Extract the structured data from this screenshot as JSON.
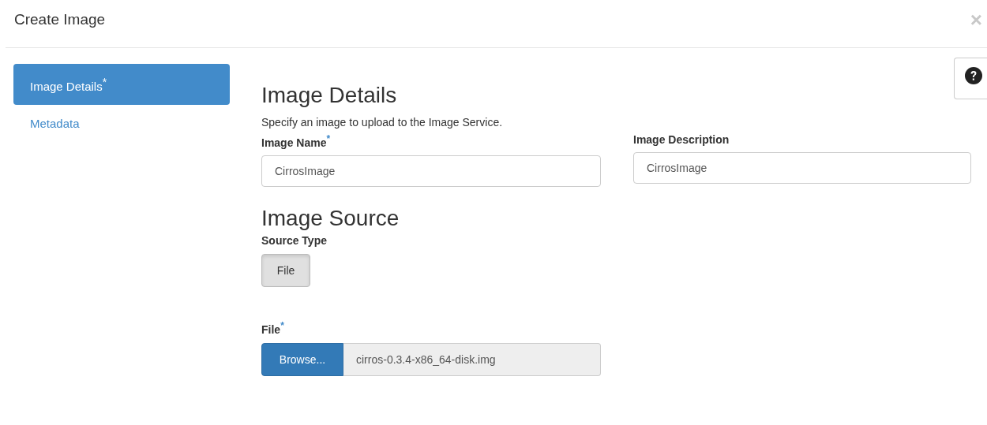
{
  "window": {
    "title": "Create Image",
    "close": "×"
  },
  "sidebar": {
    "items": [
      {
        "label": "Image Details",
        "required_mark": "*",
        "selected": true
      },
      {
        "label": "Metadata",
        "selected": false
      }
    ]
  },
  "help_button": {
    "kind": "help"
  },
  "details": {
    "heading": "Image Details",
    "description": "Specify an image to upload to the Image Service.",
    "fields": [
      {
        "label": "Image Name",
        "required_mark": "*",
        "value": "CirrosImage"
      },
      {
        "label": "Image Description",
        "value": "CirrosImage"
      }
    ]
  },
  "source": {
    "heading": "Image Source",
    "source_type_label": "Source Type",
    "source_types": [
      {
        "label": "File",
        "selected": true
      }
    ],
    "file": {
      "label": "File",
      "required_mark": "*",
      "button": "Browse...",
      "value": "cirros-0.3.4-x86_64-disk.img"
    }
  }
}
